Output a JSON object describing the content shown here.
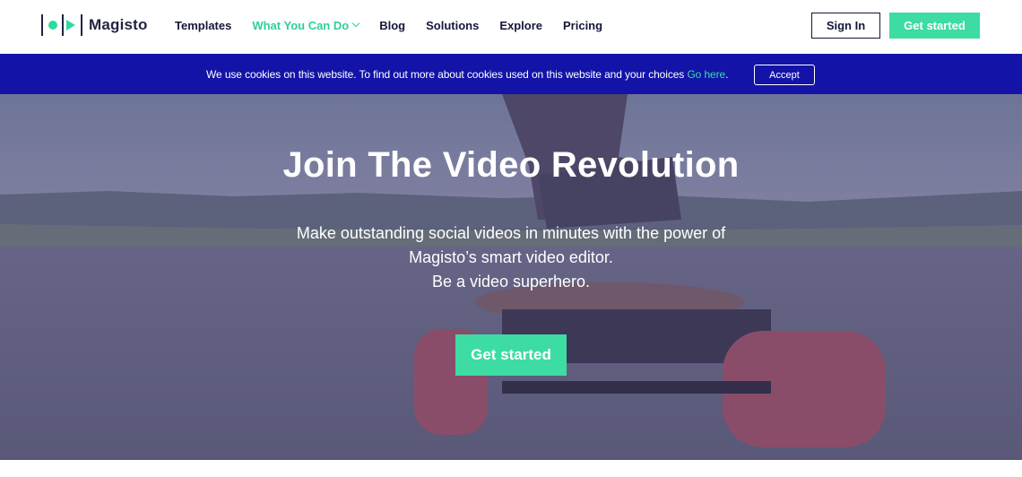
{
  "brand": {
    "name": "Magisto",
    "accent_color": "#3ddca3",
    "nav_text_color": "#14173a"
  },
  "nav": {
    "items": [
      {
        "label": "Templates",
        "active": false
      },
      {
        "label": "What You Can Do",
        "active": true,
        "has_dropdown": true
      },
      {
        "label": "Blog",
        "active": false
      },
      {
        "label": "Solutions",
        "active": false
      },
      {
        "label": "Explore",
        "active": false
      },
      {
        "label": "Pricing",
        "active": false
      }
    ],
    "sign_in": "Sign In",
    "get_started": "Get started"
  },
  "cookie_bar": {
    "text": "We use cookies on this website. To find out more about cookies used on this website and your choices ",
    "link": "Go here",
    "suffix": ".",
    "accept": "Accept",
    "bg_color": "#1313a8"
  },
  "hero": {
    "title": "Join The Video Revolution",
    "subtitle_lines": [
      "Make outstanding social videos in minutes with the power of",
      "Magisto’s smart video editor.",
      "Be a video superhero."
    ],
    "cta": "Get started"
  },
  "icons": [
    "logo-bar-icon",
    "logo-dot-icon",
    "logo-play-icon",
    "chevron-down-icon"
  ]
}
